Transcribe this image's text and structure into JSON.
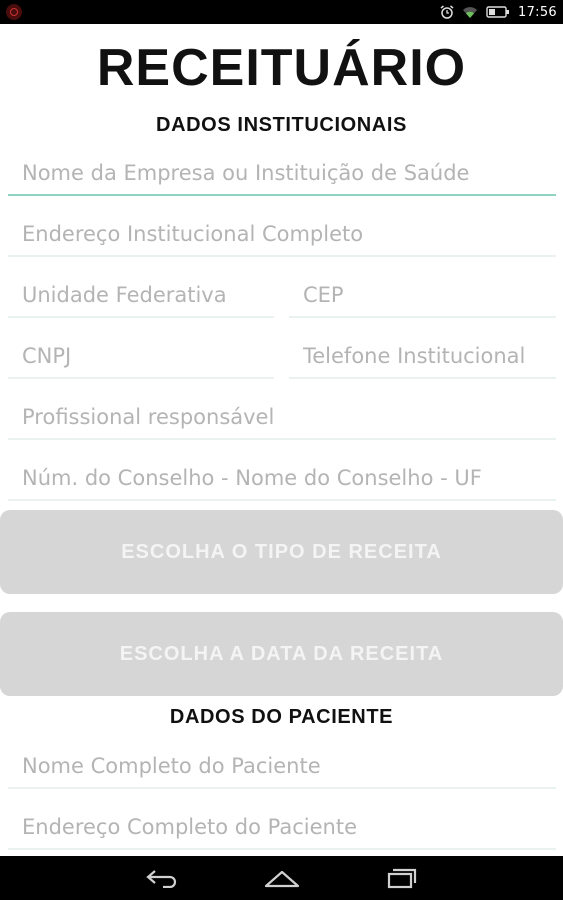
{
  "status_bar": {
    "time": "17:56",
    "icons": [
      "notification-icon",
      "alarm-icon",
      "wifi-icon",
      "battery-icon"
    ]
  },
  "app": {
    "title": "RECEITUÁRIO"
  },
  "institutional": {
    "section_title": "DADOS INSTITUCIONAIS",
    "company_placeholder": "Nome da Empresa ou Instituição de Saúde",
    "address_placeholder": "Endereço Institucional Completo",
    "state_placeholder": "Unidade Federativa",
    "cep_placeholder": "CEP",
    "cnpj_placeholder": "CNPJ",
    "phone_placeholder": "Telefone Institucional",
    "professional_placeholder": "Profissional responsável",
    "council_placeholder": "Núm. do Conselho - Nome do Conselho - UF"
  },
  "actions": {
    "prescription_type_label": "ESCOLHA O TIPO DE RECEITA",
    "prescription_date_label": "ESCOLHA A DATA DA RECEITA"
  },
  "patient": {
    "section_title": "DADOS DO PACIENTE",
    "name_placeholder": "Nome Completo do Paciente",
    "address_placeholder": "Endereço Completo do Paciente"
  },
  "colors": {
    "active_underline": "#8fd3c3",
    "button_bg": "#d6d6d6",
    "button_text": "#f4f4f4"
  },
  "nav_bar": {
    "icons": [
      "back-icon",
      "home-icon",
      "recent-apps-icon"
    ]
  }
}
